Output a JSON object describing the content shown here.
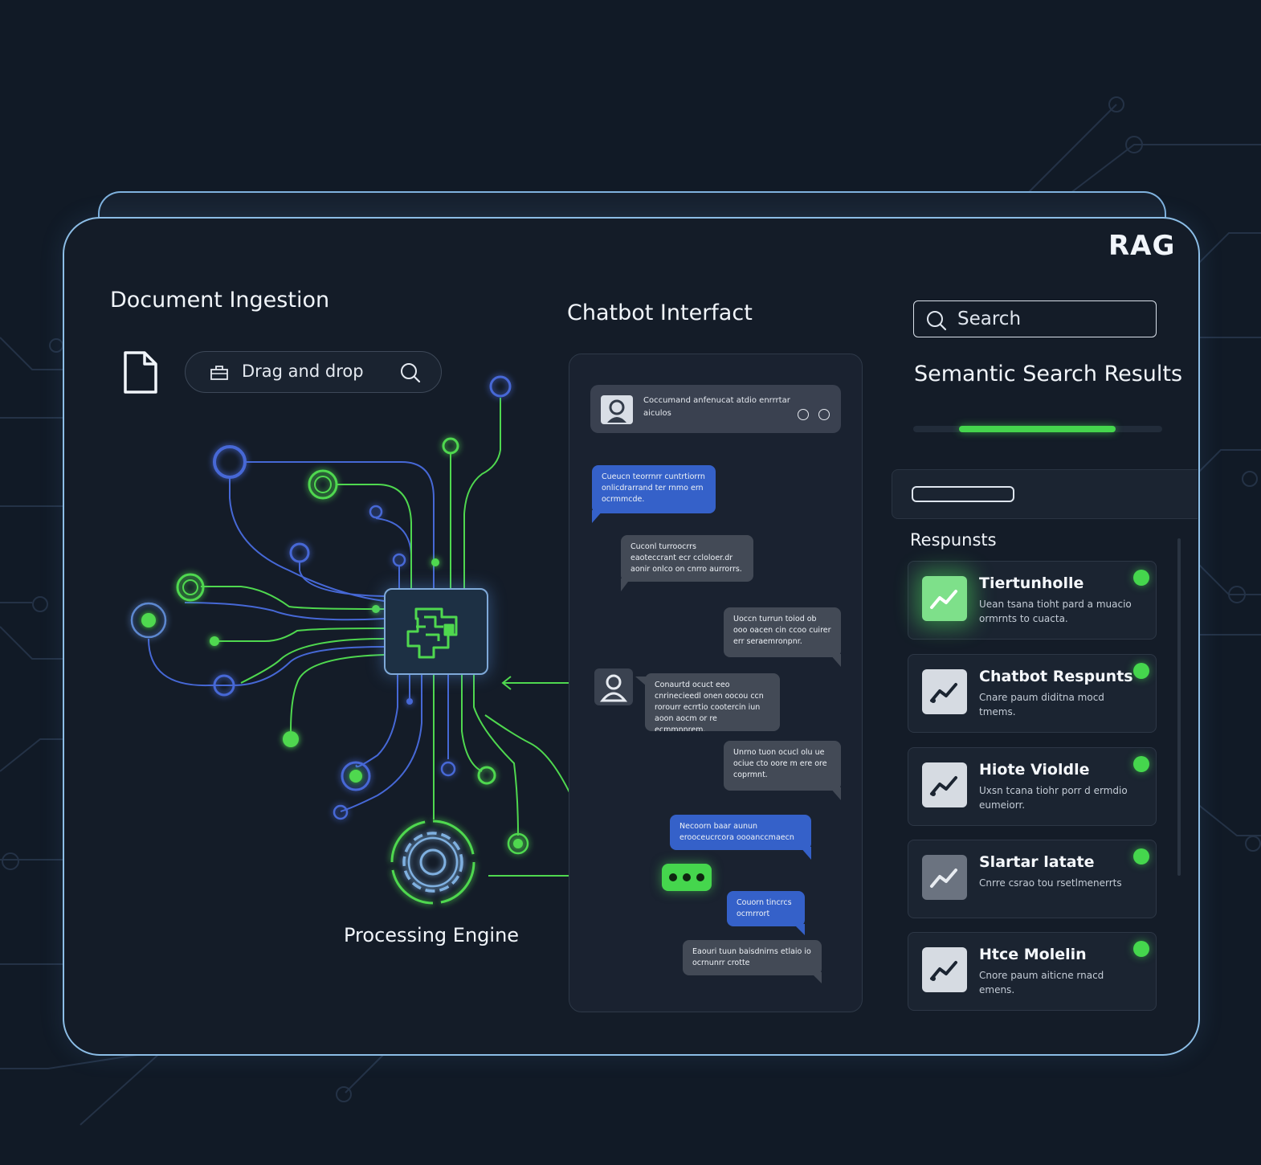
{
  "app": {
    "title": "RAG"
  },
  "ingestion": {
    "title": "Document Ingestion",
    "dropzone_label": "Drag and drop",
    "document_icon": "document-icon",
    "upload_icon": "upload-tray-icon",
    "search_icon": "search-icon"
  },
  "engine": {
    "label": "Processing Engine",
    "icon": "gear-icon",
    "chip_icon": "brain-chip-icon"
  },
  "chat": {
    "title": "Chatbot Interfact",
    "header_text": "Coccumand anfenucat atdio enrrrtar aiculos",
    "messages": [
      {
        "role": "bot",
        "color": "blue",
        "text": "Cueucn teorrnrr cuntrtiorrn onlicdrarrand ter rnmo ern ocrmmcde."
      },
      {
        "role": "user",
        "color": "gray",
        "text": "Cuconl turroocrrs eaoteccrant ecr ccloloer.dr aonir onlco on cnrro aurrorrs."
      },
      {
        "role": "bot",
        "color": "gray",
        "text": "Uoccn turrun toiod ob ooo oacen cin ccoo cuirer err seraemronpnr."
      },
      {
        "role": "user",
        "color": "gray",
        "text": "Conaurtd ocuct eeo cnrinecieedl onen oocou ccn rorourr ecrrtio cootercin iun aoon aocm or re ecmmnnrem."
      },
      {
        "role": "bot",
        "color": "gray",
        "text": "Unrno tuon ocucl olu ue ociue cto oore m ere ore coprmnt."
      },
      {
        "role": "bot",
        "color": "blue",
        "text": "Necoorn baar aunun erooceucrcora oooanccmaecn"
      },
      {
        "role": "bot",
        "color": "blue",
        "text": "Couorn tincrcs ocmrrort"
      },
      {
        "role": "user",
        "color": "gray",
        "text": "Eaouri tuun baisdnirns etlaio io ocrnunrr crotte"
      }
    ]
  },
  "search": {
    "placeholder": "Search",
    "results_title": "Semantic Search Results",
    "progress": 0.63,
    "responses_label": "Respunsts",
    "cards": [
      {
        "title": "Tiertunholle",
        "desc": "Uean tsana tioht pard a muacio ormrnts to cuacta.",
        "icon": "trend-chart-icon",
        "style": "glow"
      },
      {
        "title": "Chatbot Respunts",
        "desc": "Cnare paum diditna mocd tmems.",
        "icon": "trend-chart-icon",
        "style": "light"
      },
      {
        "title": "Hiote Violdle",
        "desc": "Uxsn tcana tiohr porr d ermdio eumeiorr.",
        "icon": "trend-chart-icon",
        "style": "light"
      },
      {
        "title": "Slartar latate",
        "desc": "Cnrre csrao tou rsetlmenerrts",
        "icon": "trend-chart-icon",
        "style": "dark"
      },
      {
        "title": "Htce Molelin",
        "desc": "Cnore paum aiticne rnacd emens.",
        "icon": "trend-chart-icon",
        "style": "light"
      }
    ]
  },
  "colors": {
    "accent_green": "#45d64d",
    "accent_blue": "#3561c9",
    "frame": "#8cbde6",
    "background": "#111a26"
  }
}
